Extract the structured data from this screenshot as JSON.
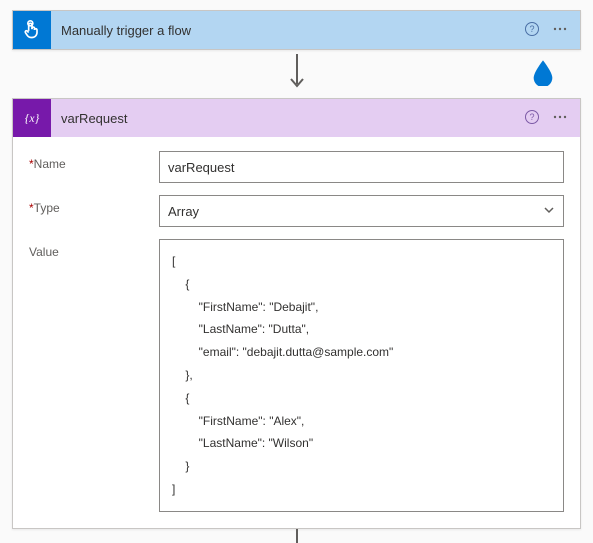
{
  "trigger": {
    "title": "Manually trigger a flow"
  },
  "action": {
    "title": "varRequest",
    "fields": {
      "name_label": "Name",
      "name_value": "varRequest",
      "type_label": "Type",
      "type_value": "Array",
      "value_label": "Value",
      "value_text": "[\n    {\n        \"FirstName\": \"Debajit\",\n        \"LastName\": \"Dutta\",\n        \"email\": \"debajit.dutta@sample.com\"\n    },\n    {\n        \"FirstName\": \"Alex\",\n        \"LastName\": \"Wilson\"\n    }\n]"
    }
  }
}
